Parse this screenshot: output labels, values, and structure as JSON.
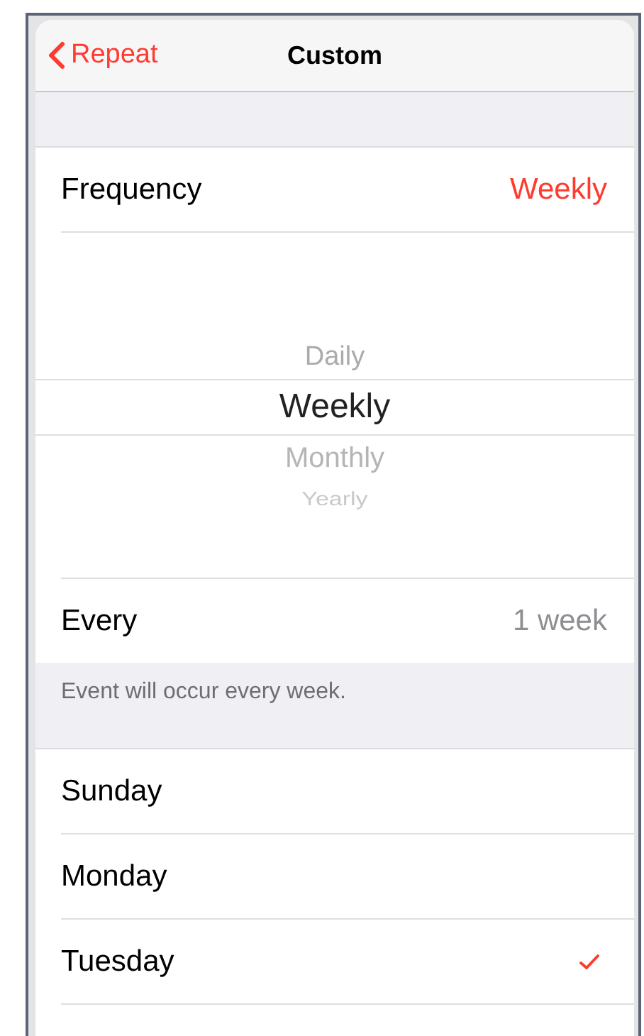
{
  "nav_bar": {
    "back_label": "Repeat",
    "title": "Custom"
  },
  "frequency": {
    "label": "Frequency",
    "value": "Weekly"
  },
  "frequency_picker": [
    {
      "label": "Daily",
      "selected": false
    },
    {
      "label": "Weekly",
      "selected": true
    },
    {
      "label": "Monthly",
      "selected": false
    },
    {
      "label": "Yearly",
      "selected": false
    }
  ],
  "every": {
    "label": "Every",
    "value": "1 week"
  },
  "footer_note": "Event will occur every week.",
  "days": [
    {
      "label": "Sunday",
      "checked": false
    },
    {
      "label": "Monday",
      "checked": false
    },
    {
      "label": "Tuesday",
      "checked": true
    }
  ]
}
